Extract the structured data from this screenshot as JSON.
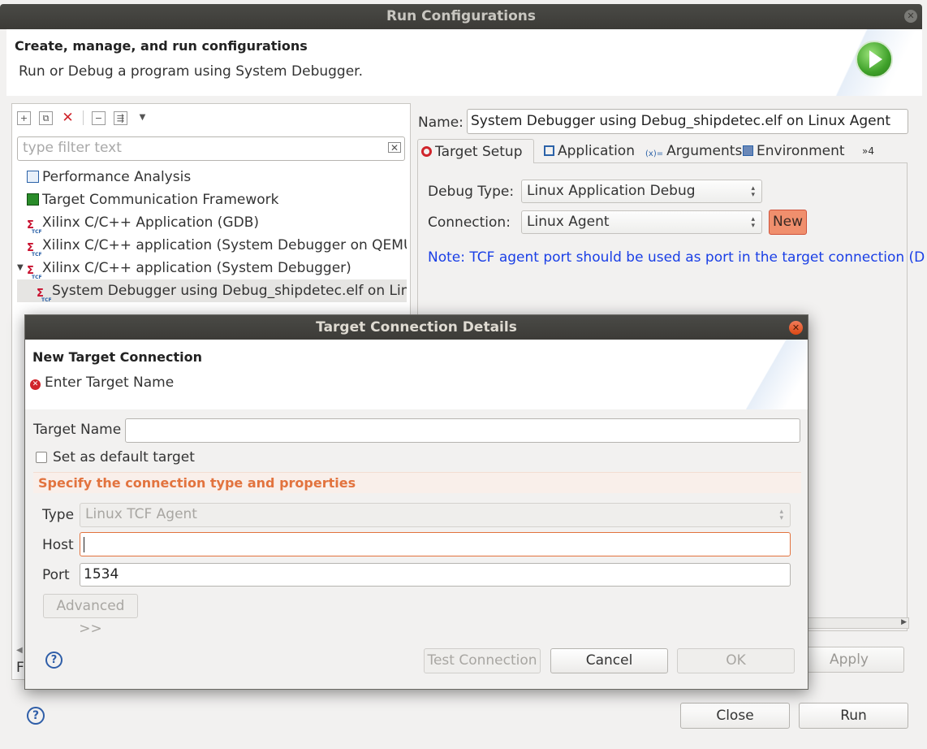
{
  "window": {
    "title": "Run Configurations",
    "header_title": "Create, manage, and run configurations",
    "header_desc": "Run or Debug a program using System Debugger."
  },
  "left": {
    "filter_placeholder": "type filter text",
    "tree": [
      {
        "label": "Performance Analysis",
        "icon": "performance-icon"
      },
      {
        "label": "Target Communication Framework",
        "icon": "tcf-icon"
      },
      {
        "label": "Xilinx C/C++ Application (GDB)",
        "icon": "xilinx-gdb-icon"
      },
      {
        "label": "Xilinx C/C++ application (System Debugger on QEMU)",
        "icon": "xilinx-tcf-icon"
      },
      {
        "label": "Xilinx C/C++ application (System Debugger)",
        "icon": "xilinx-tcf-icon",
        "expanded": true
      },
      {
        "label": "System Debugger using Debug_shipdetec.elf on Linux Agent",
        "icon": "xilinx-tcf-icon",
        "selected": true
      }
    ]
  },
  "right": {
    "name_label": "Name:",
    "name_value": "System Debugger using Debug_shipdetec.elf on Linux Agent",
    "tabs": [
      {
        "label": "Target Setup",
        "active": true
      },
      {
        "label": "Application"
      },
      {
        "label": "Arguments"
      },
      {
        "label": "Environment"
      },
      {
        "label": "»4"
      }
    ],
    "debug_type_label": "Debug Type:",
    "debug_type_value": "Linux Application Debug",
    "connection_label": "Connection:",
    "connection_value": "Linux Agent",
    "new_button": "New",
    "note": "Note: TCF agent port should be used as port in the target connection (D",
    "apply_button": "Apply"
  },
  "footer": {
    "close_button": "Close",
    "run_button": "Run"
  },
  "dialog": {
    "title": "Target Connection Details",
    "header_title": "New Target Connection",
    "error_message": "Enter Target Name",
    "target_name_label": "Target Name",
    "target_name_value": "",
    "default_checkbox_label": "Set as default target",
    "default_checked": false,
    "section_title": "Specify the connection type and properties",
    "type_label": "Type",
    "type_value": "Linux TCF Agent",
    "host_label": "Host",
    "host_value": "",
    "port_label": "Port",
    "port_value": "1534",
    "advanced_button": "Advanced >>",
    "test_button": "Test Connection",
    "cancel_button": "Cancel",
    "ok_button": "OK"
  },
  "colors": {
    "accent_orange": "#e2733e",
    "note_blue": "#1a3fe6",
    "new_button_bg": "#f08f6d",
    "titlebar_bg": "#3c3b37"
  }
}
